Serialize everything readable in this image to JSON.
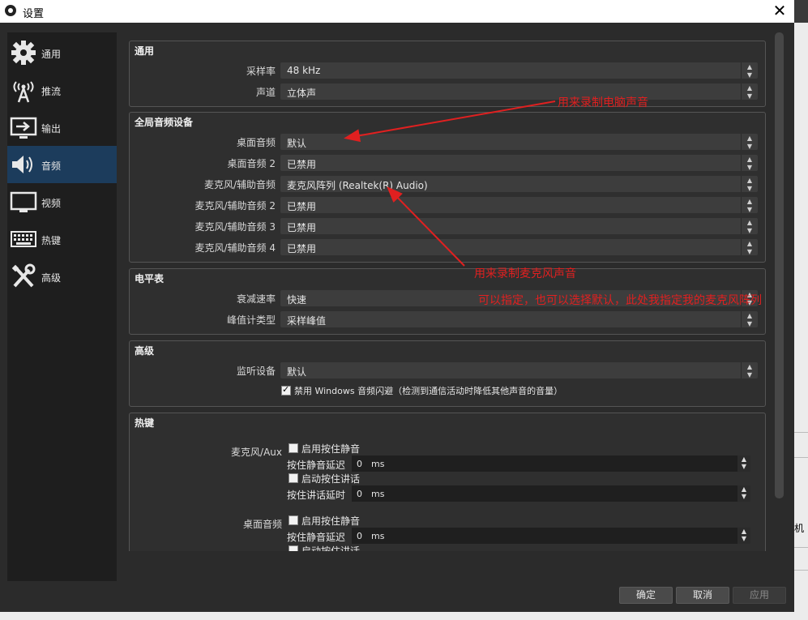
{
  "window": {
    "title": "设置",
    "close_glyph": "✕"
  },
  "sidebar": {
    "items": [
      {
        "label": "通用",
        "icon": "gear-icon"
      },
      {
        "label": "推流",
        "icon": "broadcast-icon"
      },
      {
        "label": "输出",
        "icon": "output-icon"
      },
      {
        "label": "音频",
        "icon": "speaker-icon",
        "active": true
      },
      {
        "label": "视频",
        "icon": "monitor-icon"
      },
      {
        "label": "热键",
        "icon": "keyboard-icon"
      },
      {
        "label": "高级",
        "icon": "tools-icon"
      }
    ]
  },
  "general": {
    "title": "通用",
    "sample_rate": {
      "label": "采样率",
      "value": "48 kHz"
    },
    "channels": {
      "label": "声道",
      "value": "立体声"
    }
  },
  "global_devices": {
    "title": "全局音频设备",
    "rows": [
      {
        "label": "桌面音频",
        "value": "默认"
      },
      {
        "label": "桌面音频 2",
        "value": "已禁用"
      },
      {
        "label": "麦克风/辅助音频",
        "value": "麦克风阵列 (Realtek(R) Audio)"
      },
      {
        "label": "麦克风/辅助音频 2",
        "value": "已禁用"
      },
      {
        "label": "麦克风/辅助音频 3",
        "value": "已禁用"
      },
      {
        "label": "麦克风/辅助音频 4",
        "value": "已禁用"
      }
    ]
  },
  "meters": {
    "title": "电平表",
    "decay": {
      "label": "衰减速率",
      "value": "快速"
    },
    "peak": {
      "label": "峰值计类型",
      "value": "采样峰值"
    }
  },
  "advanced": {
    "title": "高级",
    "monitor": {
      "label": "监听设备",
      "value": "默认"
    },
    "ducking": {
      "label": "禁用 Windows 音频闪避（检测到通信活动时降低其他声音的音量）",
      "checked": true
    }
  },
  "hotkeys": {
    "title": "热键",
    "mic": {
      "label": "麦克风/Aux",
      "push_to_mute": "启用按住静音",
      "mute_delay_label": "按住静音延迟",
      "mute_delay_value": "0",
      "push_to_talk": "启动按住讲话",
      "talk_delay_label": "按住讲话延时",
      "talk_delay_value": "0",
      "unit": "ms"
    },
    "desktop": {
      "label": "桌面音频",
      "push_to_mute": "启用按住静音",
      "mute_delay_label": "按住静音延迟",
      "mute_delay_value": "0",
      "push_to_talk": "启动按住讲话",
      "unit": "ms"
    }
  },
  "buttons": {
    "ok": "确定",
    "cancel": "取消",
    "apply": "应用"
  },
  "annotations": {
    "desktop_note": "用来录制电脑声音",
    "mic_note": "用来录制麦克风声音",
    "mic_note2": "可以指定，也可以选择默认，此处我指定我的麦克风阵列"
  },
  "background_fragment": "机",
  "colors": {
    "accent_active": "#1c3c5c",
    "annotation": "#e02020",
    "panel": "#2b2b2b"
  }
}
